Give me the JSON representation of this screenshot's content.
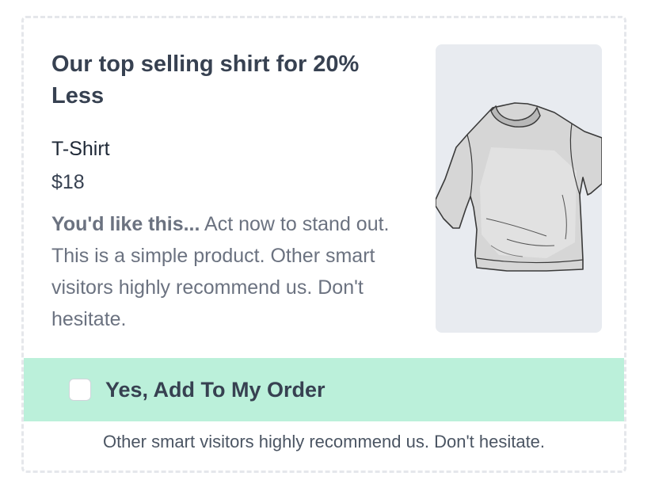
{
  "offer": {
    "headline": "Our top selling shirt for 20% Less",
    "product": {
      "name": "T-Shirt",
      "price": "$18",
      "image_icon": "t-shirt-illustration"
    },
    "description": {
      "lead": "You'd like this...",
      "body": " Act now to stand out. This is a simple product. Other smart visitors highly recommend us. Don't hesitate."
    },
    "cta": {
      "label": "Yes, Add To My Order",
      "checked": false,
      "background_color": "#bbf0da"
    },
    "footer_note": "Other smart visitors highly recommend us. Don't hesitate."
  }
}
